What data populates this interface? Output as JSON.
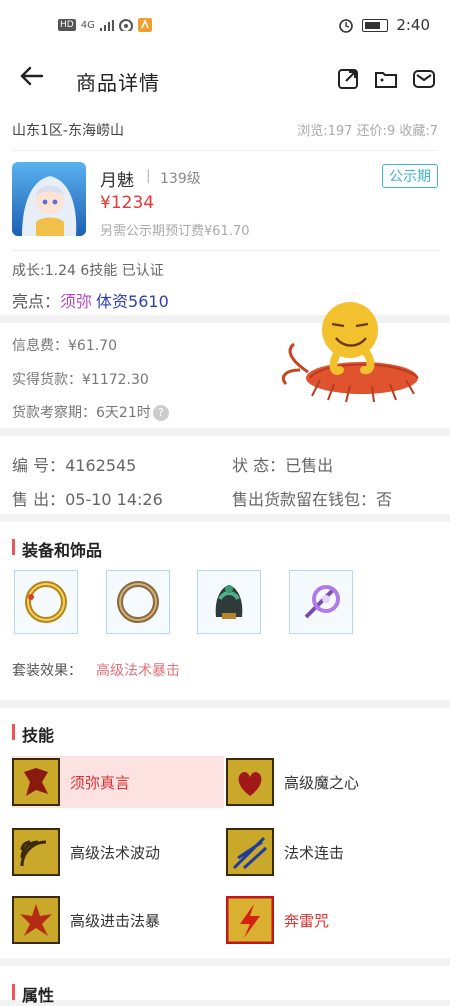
{
  "status_bar": {
    "hd": "HD",
    "network": "4G",
    "time": "2:40"
  },
  "nav": {
    "title": "商品详情"
  },
  "listing": {
    "server": "山东1区-东海崂山",
    "stats": "浏览:197 还价:9 收藏:7",
    "name": "月魅",
    "separator": "|",
    "level": "139级",
    "price": "¥1234",
    "fee_note": "另需公示期预订费¥61.70",
    "badge": "公示期",
    "growth": "成长:1.24 6技能 已认证",
    "highlight_label": "亮点：",
    "highlight_1": "须弥",
    "highlight_2": "体资5610"
  },
  "fees": {
    "info_fee": "信息费：¥61.70",
    "actual_payment": "实得货款：¥1172.30",
    "review_period": "货款考察期：6天21时",
    "help": "?"
  },
  "info": {
    "id_label": "编 号：",
    "id_value": "4162545",
    "status_label": "状 态：",
    "status_value": "已售出",
    "sold_label": "售 出：",
    "sold_value": "05-10 14:26",
    "wallet_label": "售出货款留在钱包：",
    "wallet_value": "否"
  },
  "equipment": {
    "title": "装备和饰品",
    "items": [
      "gold-ring-icon",
      "bronze-ring-icon",
      "helmet-icon",
      "purple-weapon-icon"
    ],
    "set_label": "套装效果：",
    "set_value": "高级法术暴击"
  },
  "skills": {
    "title": "技能",
    "items": [
      {
        "name": "须弥真言",
        "highlighted": true
      },
      {
        "name": "高级魔之心",
        "highlighted": false
      },
      {
        "name": "高级法术波动",
        "highlighted": false
      },
      {
        "name": "法术连击",
        "highlighted": false
      },
      {
        "name": "高级进击法暴",
        "highlighted": false
      },
      {
        "name": "奔雷咒",
        "highlighted": false
      }
    ]
  },
  "attributes": {
    "title": "属性"
  },
  "colors": {
    "price": "#e33333",
    "accent": "#3db5d6",
    "highlight_purple": "#b646c9",
    "highlight_blue": "#2f3fb0",
    "section_bar": "#e55555"
  }
}
